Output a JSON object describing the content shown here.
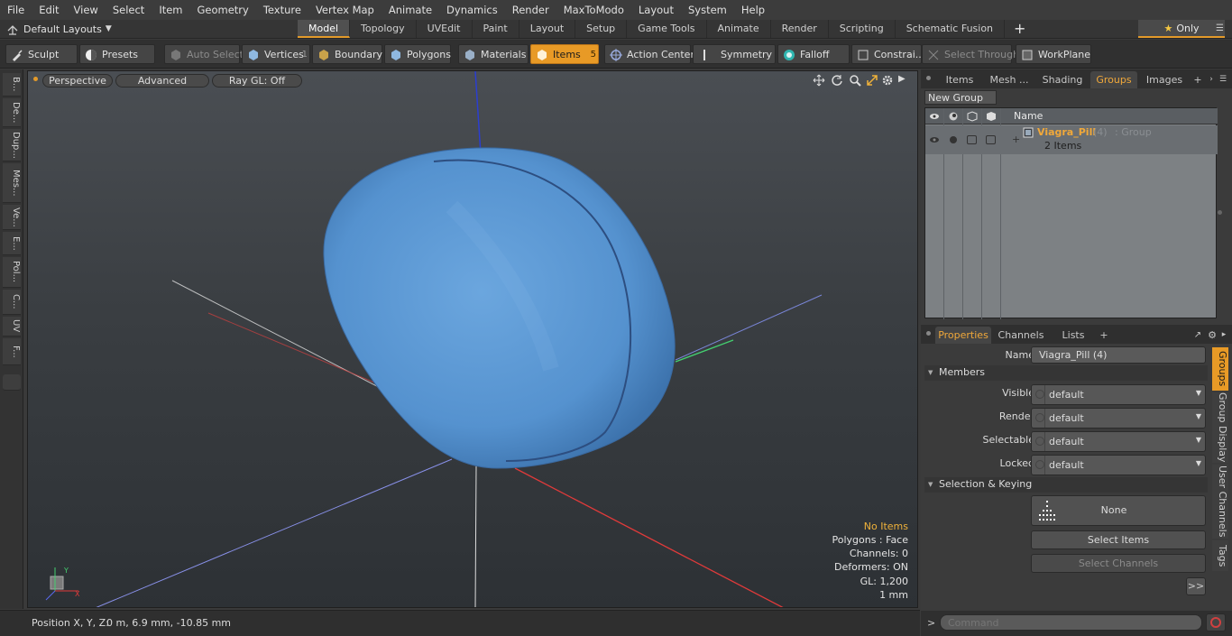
{
  "menu": [
    "File",
    "Edit",
    "View",
    "Select",
    "Item",
    "Geometry",
    "Texture",
    "Vertex Map",
    "Animate",
    "Dynamics",
    "Render",
    "MaxToModo",
    "Layout",
    "System",
    "Help"
  ],
  "layouts_label": "Default Layouts",
  "main_tabs": [
    "Model",
    "Topology",
    "UVEdit",
    "Paint",
    "Layout",
    "Setup",
    "Game Tools",
    "Animate",
    "Render",
    "Scripting",
    "Schematic Fusion"
  ],
  "active_tab": "Model",
  "only_label": "Only",
  "toolbar": {
    "sculpt": "Sculpt",
    "presets": "Presets",
    "auto_select": "Auto Select",
    "vertices": "Vertices",
    "vertices_count": "1",
    "boundary": "Boundary",
    "polygons": "Polygons",
    "materials": "Materials",
    "items": "Items",
    "items_count": "5",
    "action_center": "Action Center",
    "symmetry": "Symmetry",
    "falloff": "Falloff",
    "constraints": "Constrai...",
    "select_through": "Select Through",
    "workplane": "WorkPlane"
  },
  "left_tabs": [
    "B...",
    "De...",
    "Dup...",
    "Mes...",
    "Ve...",
    "E...",
    "Pol...",
    "C...",
    "UV",
    "F..."
  ],
  "viewport": {
    "perspective": "Perspective",
    "advanced": "Advanced",
    "raygl": "Ray GL: Off",
    "info": {
      "items": "No Items",
      "polygons": "Polygons : Face",
      "channels": "Channels: 0",
      "deformers": "Deformers: ON",
      "gl": "GL: 1,200",
      "scale": "1 mm"
    }
  },
  "status": {
    "label": "Position X, Y, Z:",
    "value": "0 m, 6.9 mm, -10.85 mm"
  },
  "top_panel_tabs": [
    "Items",
    "Mesh ...",
    "Shading",
    "Groups",
    "Images"
  ],
  "top_panel_active": "Groups",
  "groups": {
    "new_group": "New Group",
    "header_name": "Name",
    "group_name": "Viagra_Pill",
    "group_count": "(4)",
    "group_type": ": Group",
    "group_items": "2 Items"
  },
  "bottom_panel_tabs": [
    "Properties",
    "Channels",
    "Lists"
  ],
  "properties": {
    "name_label": "Name",
    "name_value": "Viagra_Pill (4)",
    "members_section": "Members",
    "visible_label": "Visible",
    "visible_value": "default",
    "render_label": "Render",
    "render_value": "default",
    "selectable_label": "Selectable",
    "selectable_value": "default",
    "locked_label": "Locked",
    "locked_value": "default",
    "selection_section": "Selection & Keying",
    "none_label": "None",
    "select_items": "Select Items",
    "select_channels": "Select Channels",
    "more": ">>"
  },
  "side_tabs": [
    "Groups",
    "Group Display",
    "User Channels",
    "Tags"
  ],
  "command_placeholder": "Command",
  "colors": {
    "accent": "#e89a26",
    "pill": "#5b9bd8"
  }
}
